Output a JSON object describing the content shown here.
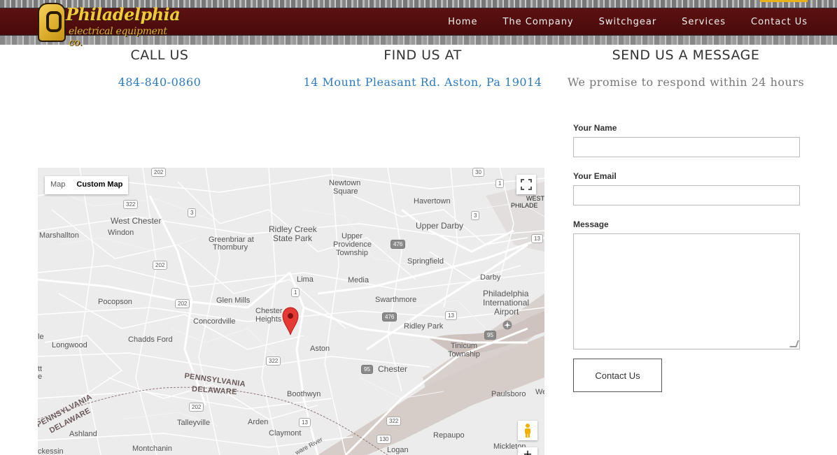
{
  "header": {
    "logo_word1": "Philadelphia",
    "logo_tm": "™",
    "logo_word2": "electrical equipment co.",
    "nav": [
      "Home",
      "The Company",
      "Switchgear",
      "Services",
      "Contact Us"
    ]
  },
  "info": {
    "call": {
      "title": "CALL US",
      "value": "484-840-0860"
    },
    "find": {
      "title": "FIND US AT",
      "value": "14 Mount Pleasant Rd. Aston, Pa 19014"
    },
    "send": {
      "title": "SEND US A MESSAGE",
      "value": "We promise to respond within 24 hours"
    }
  },
  "form": {
    "name_label": "Your Name",
    "email_label": "Your Email",
    "message_label": "Message",
    "name_value": "",
    "email_value": "",
    "message_value": "",
    "submit_label": "Contact Us"
  },
  "map": {
    "type_map": "Map",
    "type_custom": "Custom Map",
    "places": {
      "newtown_square_1": "Newtown",
      "newtown_square_2": "Square",
      "havertown": "Havertown",
      "west_phila_1": "WEST",
      "west_phila_2": "PHILADE",
      "west_chester": "West Chester",
      "windon": "Windon",
      "marshallton": "Marshallton",
      "ridley_creek_1": "Ridley Creek",
      "ridley_creek_2": "State Park",
      "greenbriar_1": "Greenbriar at",
      "greenbriar_2": "Thornbury",
      "upper_providence_1": "Upper",
      "upper_providence_2": "Providence",
      "upper_providence_3": "Township",
      "upper_darby": "Upper Darby",
      "springfield": "Springfield",
      "lima": "Lima",
      "media": "Media",
      "darby": "Darby",
      "pocopson": "Pocopson",
      "glen_mills": "Glen Mills",
      "swarthmore": "Swarthmore",
      "phl_1": "Philadelphia",
      "phl_2": "International",
      "phl_3": "Airport",
      "concordville": "Concordville",
      "chester_heights_1": "Chester",
      "chester_heights_2": "Heights",
      "ridley_park": "Ridley Park",
      "longwood": "Longwood",
      "chadds_ford": "Chadds Ford",
      "aston": "Aston",
      "tinicum_1": "Tinicum",
      "tinicum_2": "Township",
      "chester": "Chester",
      "pa_state": "PENNSYLVANIA",
      "de_state": "DELAWARE",
      "boothwyn": "Boothwyn",
      "paulsboro": "Paulsboro",
      "we": "We",
      "pa_state_2": "PENNSYLVANIA",
      "de_state_2": "DELAWARE",
      "talleyville": "Talleyville",
      "arden": "Arden",
      "claymont": "Claymont",
      "repaupo": "Repaupo",
      "ashland": "Ashland",
      "montchanin": "Montchanin",
      "logan": "Logan",
      "mickleton": "Mickleton",
      "hockessin": "ckessin",
      "delaware_river": "ware River",
      "edge_le": "le",
      "edge_tt": "tt",
      "edge_e": "e"
    },
    "shields": {
      "s202a": "202",
      "s30": "30",
      "s1a": "1",
      "s322a": "322",
      "s3a": "3",
      "s3b": "3",
      "s476a": "476",
      "s13a": "13",
      "s202b": "202",
      "s1b": "1",
      "s202c": "202",
      "s476b": "476",
      "s13b": "13",
      "s95a": "95",
      "s322b": "322",
      "s95b": "95",
      "s202d": "202",
      "s13c": "13",
      "s322c": "322",
      "s130": "130"
    }
  }
}
